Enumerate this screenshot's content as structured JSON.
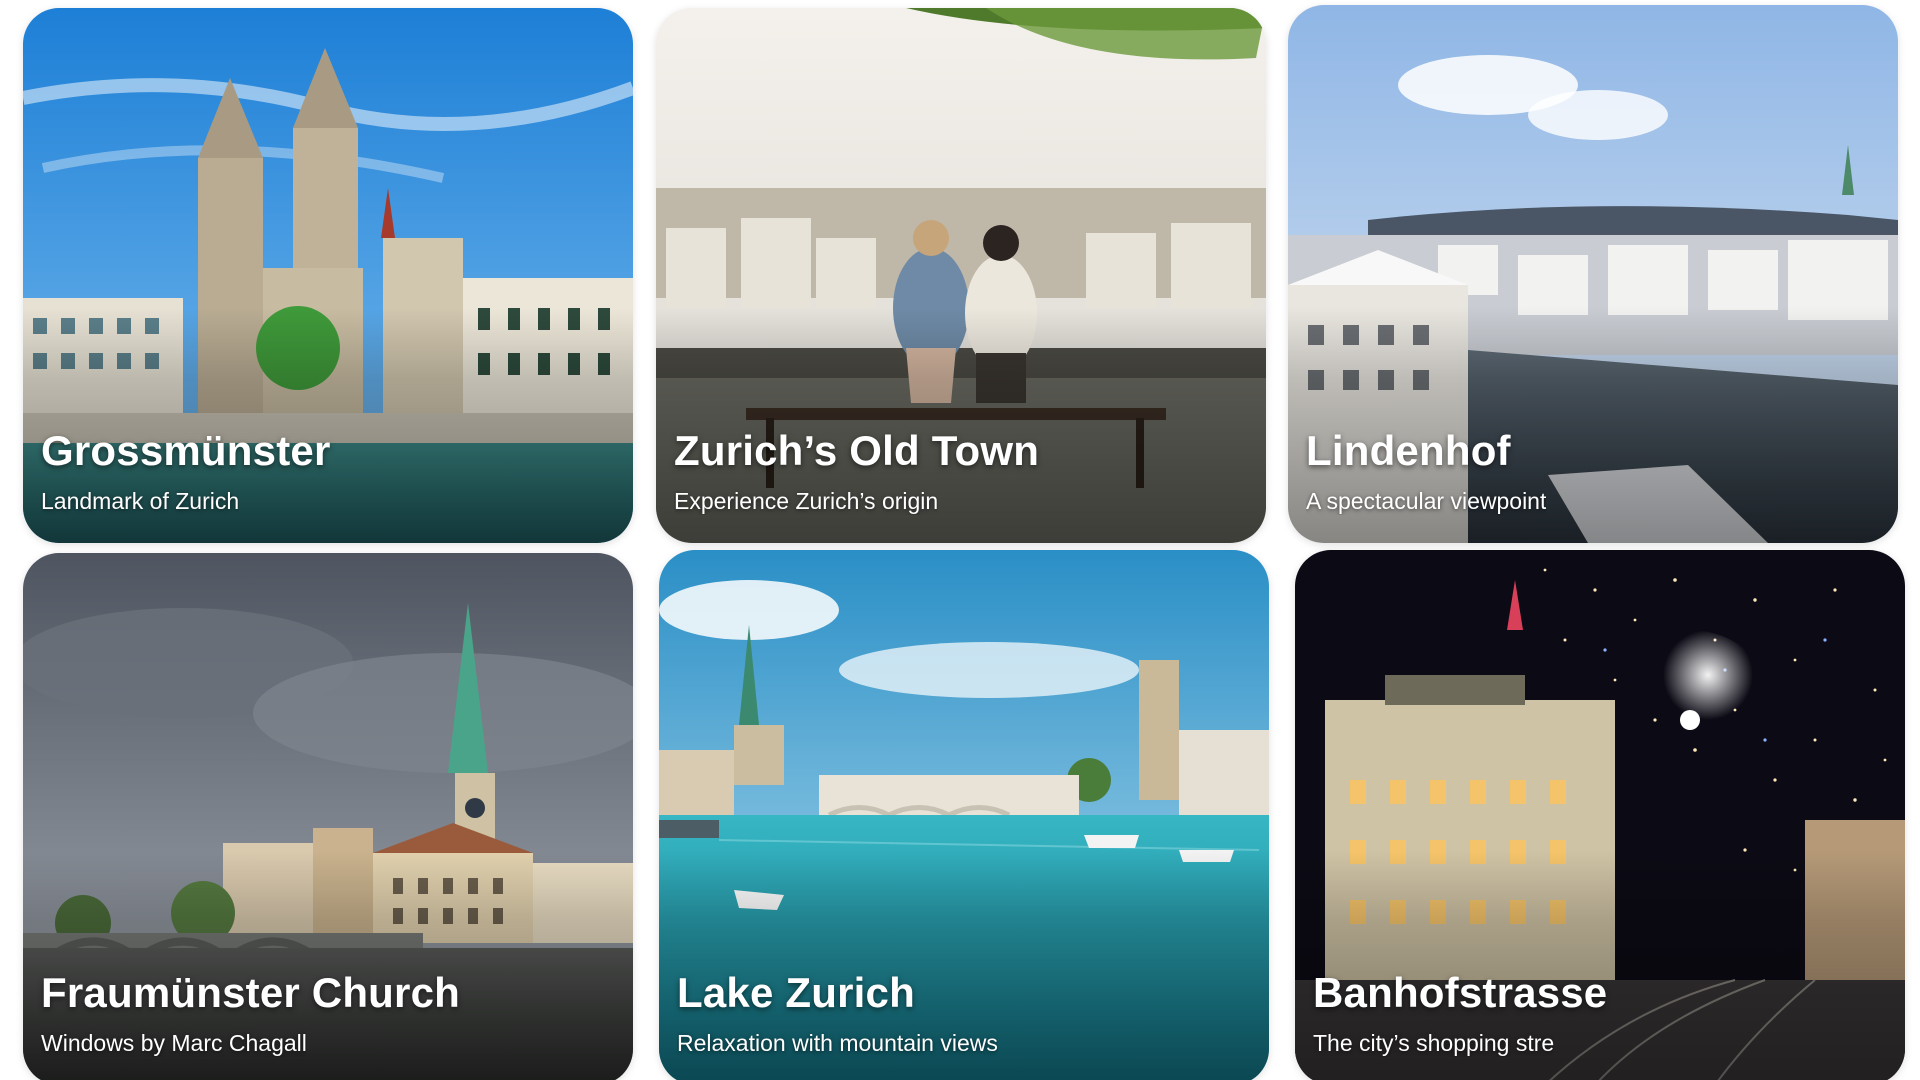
{
  "cards": [
    {
      "title": "Grossmünster",
      "subtitle": "Landmark of Zurich",
      "image_icon": "twin-tower-cathedral-image"
    },
    {
      "title": "Zurich’s Old Town",
      "subtitle": "Experience Zurich’s origin",
      "image_icon": "old-town-viewpoint-image"
    },
    {
      "title": "Lindenhof",
      "subtitle": "A spectacular viewpoint",
      "image_icon": "snowy-city-river-image"
    },
    {
      "title": "Fraumünster Church",
      "subtitle": "Windows by Marc Chagall",
      "image_icon": "church-spire-river-image"
    },
    {
      "title": "Lake Zurich",
      "subtitle": "Relaxation with mountain views",
      "image_icon": "lake-boats-image"
    },
    {
      "title": "Banhofstrasse",
      "subtitle": "The city’s shopping stre",
      "image_icon": "night-street-lights-image"
    }
  ],
  "colors": {
    "text": "#ffffff",
    "sky_blue": "#2f8fd8",
    "water_teal": "#1aa5b5",
    "night": "#0c0a14"
  }
}
